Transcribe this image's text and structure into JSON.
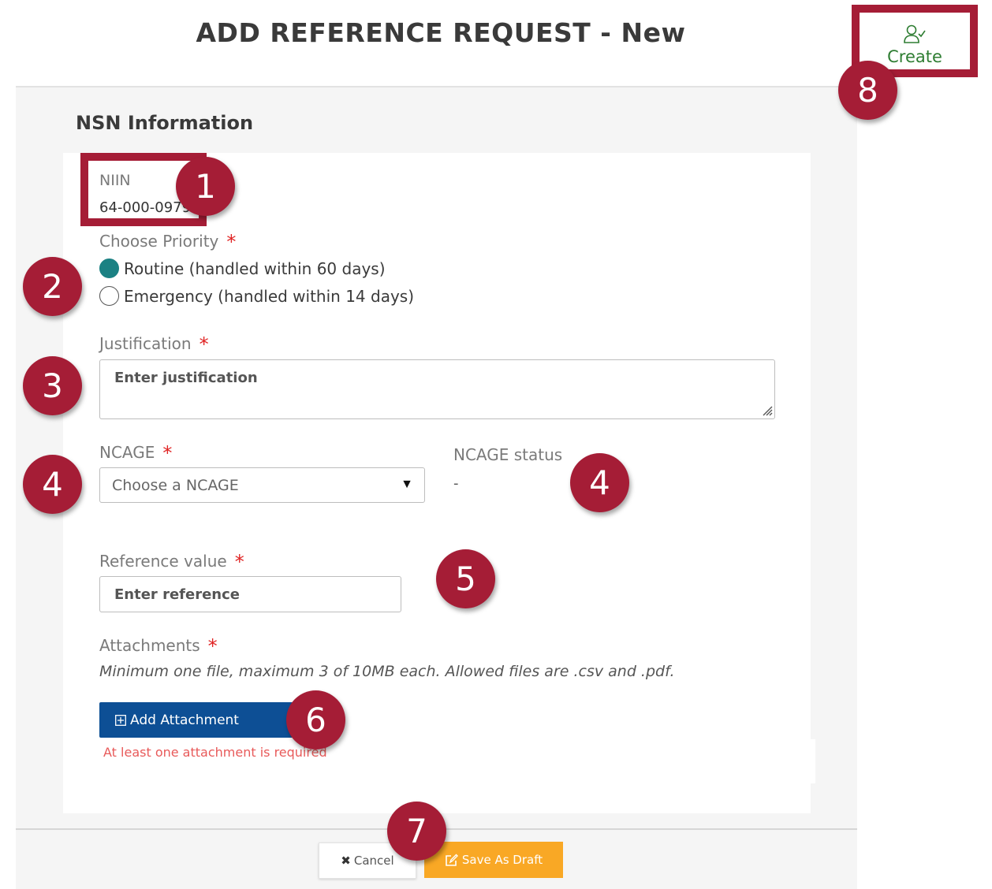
{
  "page": {
    "title": "ADD REFERENCE REQUEST - New"
  },
  "toolbar": {
    "create_label": "Create",
    "create_icon": "user-check-icon"
  },
  "section": {
    "title": "NSN Information"
  },
  "niin": {
    "label": "NIIN",
    "value": "64-000-0979"
  },
  "priority": {
    "label": "Choose Priority",
    "required_mark": "*",
    "options": [
      {
        "label": "Routine (handled within 60 days)",
        "selected": true
      },
      {
        "label": "Emergency (handled within 14 days)",
        "selected": false
      }
    ]
  },
  "justification": {
    "label": "Justification",
    "required_mark": "*",
    "placeholder": "Enter justification"
  },
  "ncage": {
    "label": "NCAGE",
    "required_mark": "*",
    "select_value": "Choose a NCAGE",
    "caret": "▼",
    "status_label": "NCAGE status",
    "status_value": "-"
  },
  "reference": {
    "label": "Reference value",
    "required_mark": "*",
    "placeholder": "Enter reference"
  },
  "attachments": {
    "label": "Attachments",
    "required_mark": "*",
    "help": "Minimum one file, maximum 3 of 10MB each. Allowed files are .csv and .pdf.",
    "add_button": "Add Attachment",
    "error": "At least one attachment is required"
  },
  "footer": {
    "cancel_label": "Cancel",
    "cancel_icon_glyph": "✖",
    "draft_label": "Save As Draft"
  },
  "callouts": [
    "1",
    "2",
    "3",
    "4",
    "4",
    "5",
    "6",
    "7",
    "8"
  ],
  "colors": {
    "accent": "#a51d36",
    "radio": "#1b8183",
    "primary": "#0d4f95",
    "draft": "#f9a825",
    "create": "#2e7d32",
    "error": "#e85a5a"
  }
}
